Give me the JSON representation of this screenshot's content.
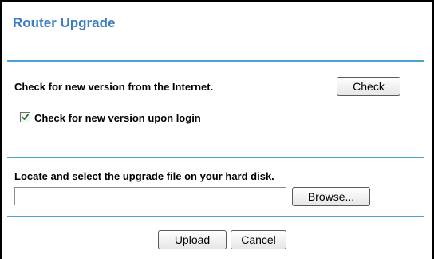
{
  "page": {
    "title": "Router Upgrade"
  },
  "check_section": {
    "label": "Check for new version from the Internet.",
    "check_button_label": "Check",
    "login_check": {
      "label": "Check for new version upon login",
      "checked": true
    }
  },
  "upload_section": {
    "label": "Locate and select the upgrade file on your hard disk.",
    "file_value": "",
    "browse_button_label": "Browse..."
  },
  "actions": {
    "upload_label": "Upload",
    "cancel_label": "Cancel"
  },
  "colors": {
    "title": "#3b7dc4",
    "rule": "#4aa3d6"
  }
}
